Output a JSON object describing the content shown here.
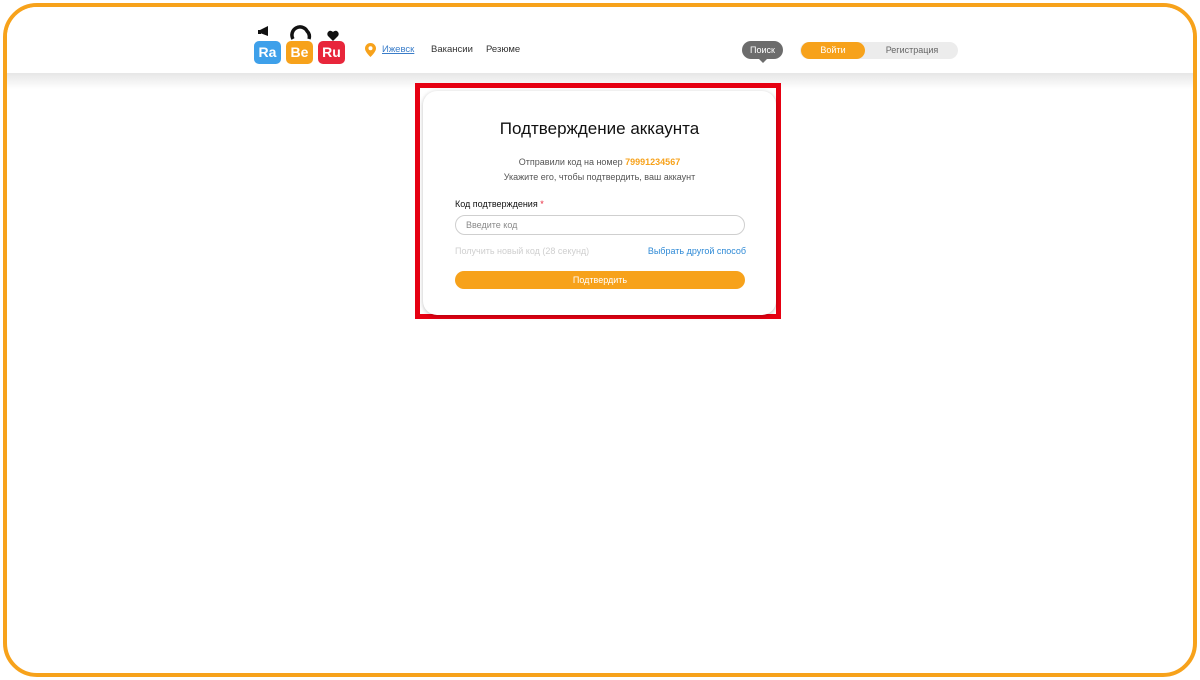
{
  "header": {
    "logo": {
      "tiles": [
        "Ra",
        "Be",
        "Ru"
      ]
    },
    "city": "Ижевск",
    "nav": {
      "vacancies": "Вакансии",
      "resume": "Резюме"
    },
    "search_label": "Поиск",
    "login_label": "Войти",
    "register_label": "Регистрация"
  },
  "card": {
    "title": "Подтверждение аккаунта",
    "sent_prefix": "Отправили код на номер",
    "phone": "79991234567",
    "instruction": "Укажите его, чтобы подтвердить, ваш аккаунт",
    "code_label": "Код подтверждения",
    "required_mark": "*",
    "code_placeholder": "Введите код",
    "resend_text": "Получить новый код (28 секунд)",
    "other_method": "Выбрать другой способ",
    "confirm_label": "Подтвердить"
  },
  "colors": {
    "accent": "#f7a21b",
    "highlight": "#e60012",
    "link": "#2f8ad6"
  },
  "icons": [
    "location-pin-icon"
  ]
}
